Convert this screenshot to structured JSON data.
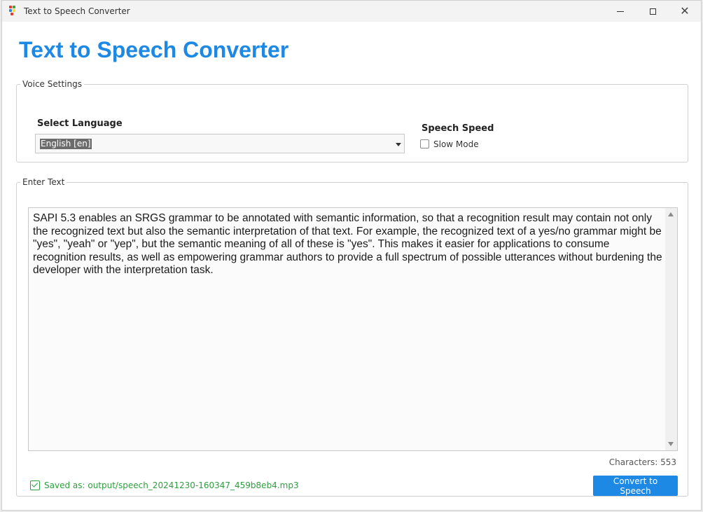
{
  "window": {
    "title": "Text to Speech Converter"
  },
  "header": {
    "title": "Text to Speech Converter",
    "color": "#1e88e5"
  },
  "voice_settings": {
    "legend": "Voice Settings",
    "language_label": "Select Language",
    "language_value": "English [en]",
    "speed_label": "Speech Speed",
    "slow_mode_label": "Slow Mode",
    "slow_mode_checked": false
  },
  "text_section": {
    "legend": "Enter Text",
    "text": "SAPI 5.3 enables an SRGS grammar to be annotated with semantic information, so that a recognition result may contain not only the recognized text but also the semantic interpretation of that text. For example, the recognized text of a yes/no grammar might be \"yes\", \"yeah\" or \"yep\", but the semantic meaning of all of these is \"yes\". This makes it easier for applications to consume recognition results, as well as empowering grammar authors to provide a full spectrum of possible utterances without burdening the developer with the interpretation task.",
    "char_count": "Characters: 553"
  },
  "status": {
    "saved_text": "Saved as: output/speech_20241230-160347_459b8eb4.mp3",
    "color": "#2e9e3e"
  },
  "actions": {
    "convert_label": "Convert to Speech"
  },
  "icons": {
    "app": "app-logo-icon",
    "minimize": "minimize-icon",
    "maximize": "maximize-icon",
    "close": "close-icon",
    "saved": "check-icon",
    "dropdown": "chevron-down-icon"
  }
}
